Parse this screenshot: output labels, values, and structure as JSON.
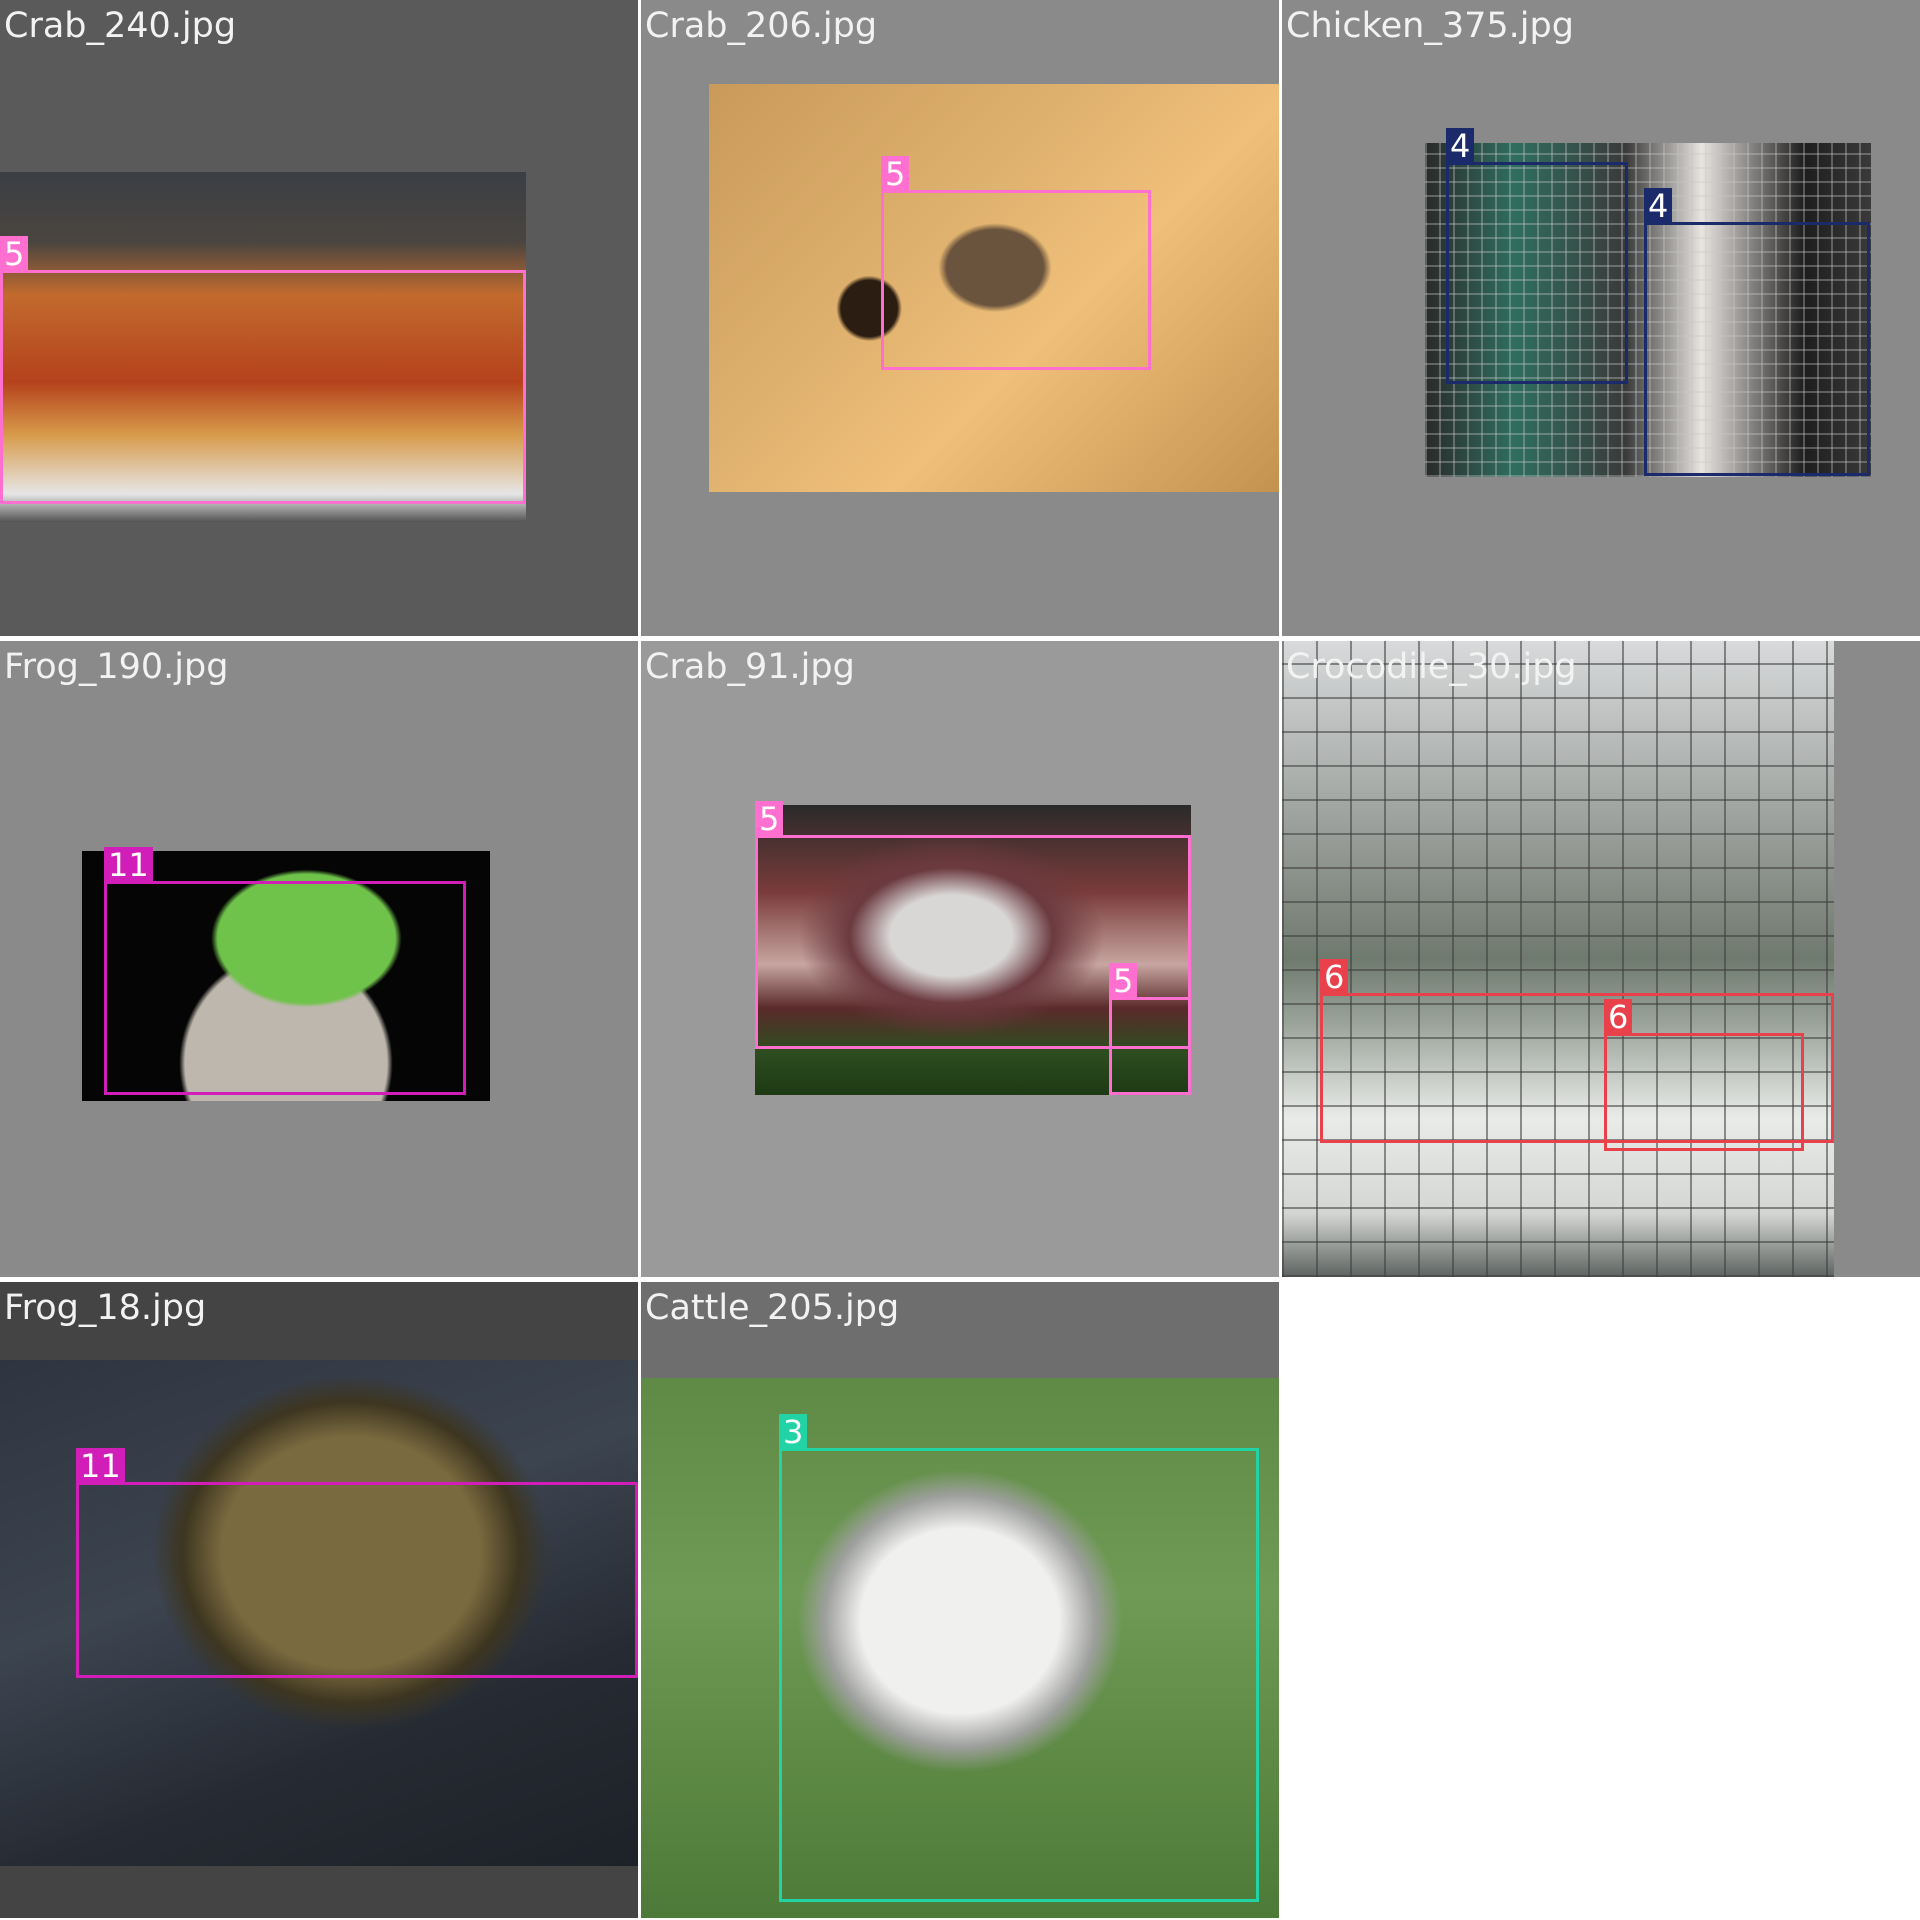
{
  "tiles": [
    {
      "filename": "Crab_240.jpg",
      "background": "#5a5a5a",
      "detections": [
        {
          "class_id": "5",
          "color": "#ff6fcf"
        }
      ]
    },
    {
      "filename": "Crab_206.jpg",
      "background": "#8a8a8a",
      "detections": [
        {
          "class_id": "5",
          "color": "#ff6fcf"
        }
      ]
    },
    {
      "filename": "Chicken_375.jpg",
      "background": "#8a8a8a",
      "detections": [
        {
          "class_id": "4",
          "color": "#1b2a6b"
        },
        {
          "class_id": "4",
          "color": "#1b2a6b"
        }
      ]
    },
    {
      "filename": "Frog_190.jpg",
      "background": "#8a8a8a",
      "detections": [
        {
          "class_id": "11",
          "color": "#d21eb8"
        }
      ]
    },
    {
      "filename": "Crab_91.jpg",
      "background": "#9a9a9a",
      "detections": [
        {
          "class_id": "5",
          "color": "#ff6fcf"
        },
        {
          "class_id": "5",
          "color": "#ff6fcf"
        }
      ]
    },
    {
      "filename": "Crocodile_30.jpg",
      "background": "#8a8a8a",
      "detections": [
        {
          "class_id": "6",
          "color": "#e8414b"
        },
        {
          "class_id": "6",
          "color": "#e8414b"
        }
      ]
    },
    {
      "filename": "Frog_18.jpg",
      "background": "#444444",
      "detections": [
        {
          "class_id": "11",
          "color": "#d21eb8"
        }
      ]
    },
    {
      "filename": "Cattle_205.jpg",
      "background": "#6e6e6e",
      "detections": [
        {
          "class_id": "3",
          "color": "#22d3a6"
        }
      ]
    }
  ]
}
